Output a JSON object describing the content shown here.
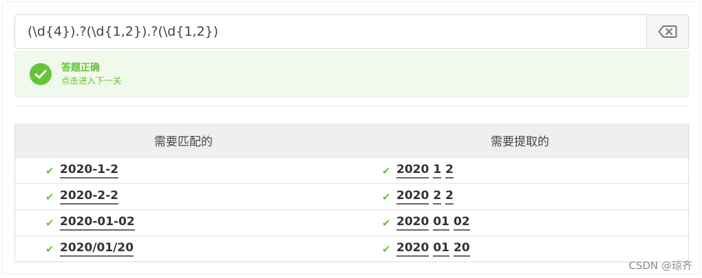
{
  "regex": {
    "value": "(\\d{4}).?(\\d{1,2}).?(\\d{1,2})",
    "placeholder": ""
  },
  "clear_button": {
    "icon": "backspace-icon"
  },
  "result": {
    "title": "答题正确",
    "subtitle": "点击进入下一关",
    "icon": "check-circle-icon",
    "color": "#67c23a"
  },
  "table": {
    "headers": [
      "需要匹配的",
      "需要提取的"
    ],
    "rows": [
      {
        "match": "2020-1-2",
        "groups": [
          "2020",
          "1",
          "2"
        ]
      },
      {
        "match": "2020-2-2",
        "groups": [
          "2020",
          "2",
          "2"
        ]
      },
      {
        "match": "2020-01-02",
        "groups": [
          "2020",
          "01",
          "02"
        ]
      },
      {
        "match": "2020/01/20",
        "groups": [
          "2020",
          "01",
          "20"
        ]
      }
    ]
  },
  "watermark": "CSDN @琼齐"
}
